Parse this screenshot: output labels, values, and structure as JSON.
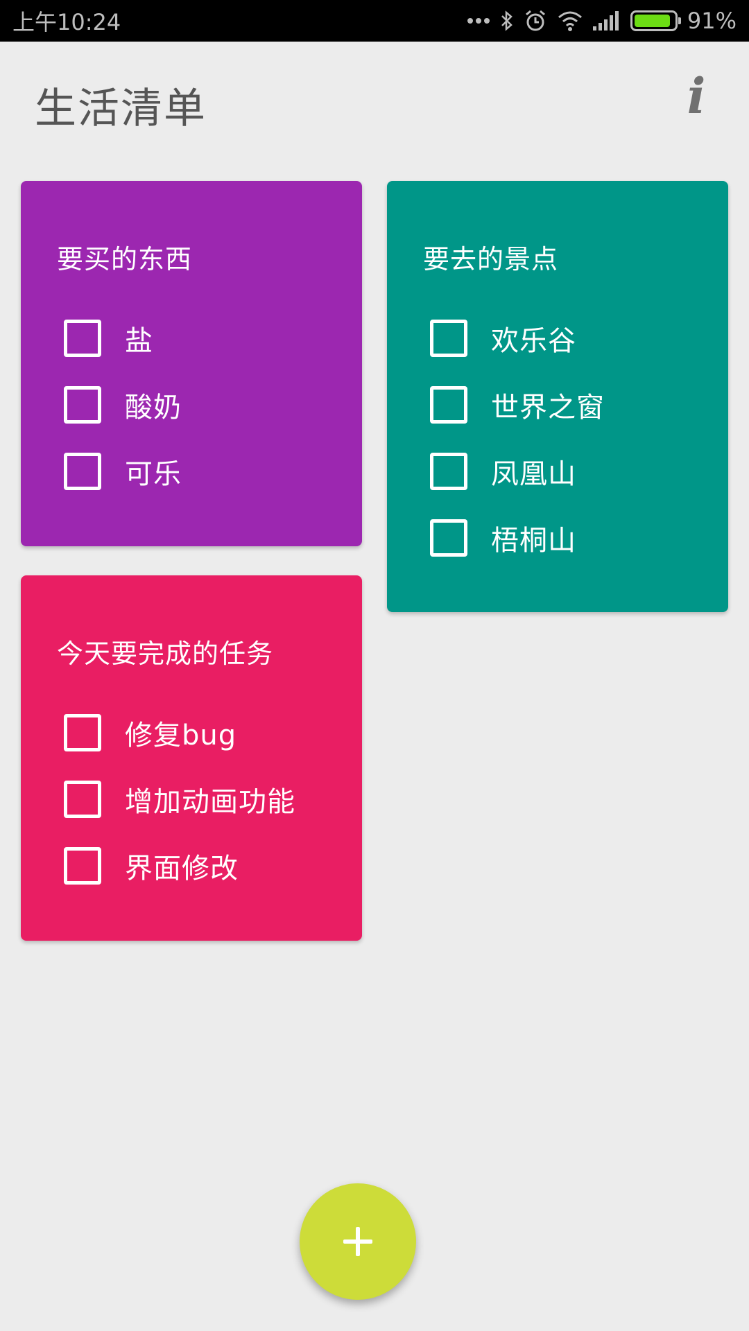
{
  "status_bar": {
    "time": "上午10:24",
    "more_icon": "more-dots-icon",
    "bluetooth_icon": "bluetooth-icon",
    "alarm_icon": "alarm-icon",
    "wifi_icon": "wifi-icon",
    "signal_icon": "signal-icon",
    "battery_level": 0.91,
    "battery_text": "91%",
    "battery_color": "#6cdc14"
  },
  "header": {
    "title": "生活清单",
    "info_label": "i"
  },
  "cards": [
    {
      "title": "要买的东西",
      "color": "#9c27b0",
      "items": [
        "盐",
        "酸奶",
        "可乐"
      ]
    },
    {
      "title": "要去的景点",
      "color": "#009688",
      "items": [
        "欢乐谷",
        "世界之窗",
        "凤凰山",
        "梧桐山"
      ]
    },
    {
      "title": "今天要完成的任务",
      "color": "#e91e63",
      "items": [
        "修复bug",
        "增加动画功能",
        "界面修改"
      ]
    }
  ],
  "fab": {
    "icon": "plus-icon",
    "color": "#cddc39"
  }
}
